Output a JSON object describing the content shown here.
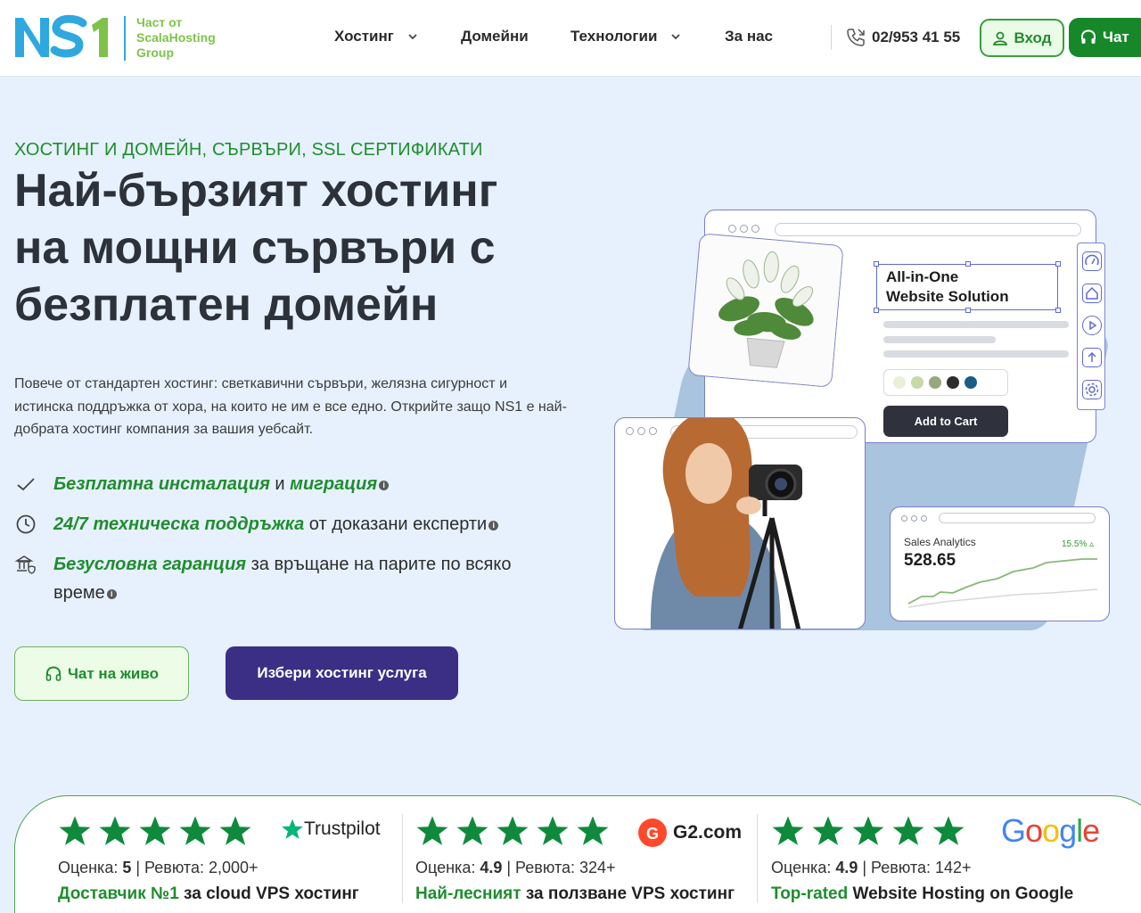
{
  "header": {
    "logo_tagline": [
      "Част от",
      "ScalaHosting",
      "Group"
    ],
    "nav": [
      {
        "label": "Хостинг",
        "has_dropdown": true
      },
      {
        "label": "Домейни",
        "has_dropdown": false
      },
      {
        "label": "Технологии",
        "has_dropdown": true
      },
      {
        "label": "За нас",
        "has_dropdown": false
      }
    ],
    "phone": "02/953 41 55",
    "login_label": "Вход",
    "chat_label": "Чат"
  },
  "hero": {
    "eyebrow": "ХОСТИНГ И ДОМЕЙН, СЪРВЪРИ, SSL СЕРТИФИКАТИ",
    "title_lines": [
      "Най-бързият хостинг",
      "на мощни сървъри с",
      "безплатен домейн"
    ],
    "description": "Повече от стандартен хостинг: светкавични сървъри, желязна сигурност и истинска поддръжка от хора, на които не им е все едно. Открийте защо NS1 е най-добрата хостинг компания за вашия уебсайт.",
    "features": [
      {
        "icon": "check-icon",
        "parts": [
          {
            "t": "Безплатна инсталация",
            "em": true
          },
          {
            "t": " и ",
            "em": false
          },
          {
            "t": "миграция",
            "em": true
          }
        ]
      },
      {
        "icon": "clock-icon",
        "parts": [
          {
            "t": "24/7 техническа поддръжка",
            "em": true
          },
          {
            "t": " от доказани експерти",
            "em": false
          }
        ]
      },
      {
        "icon": "bank-shield-icon",
        "parts": [
          {
            "t": "Безусловна гаранция",
            "em": true
          },
          {
            "t": " за връщане на парите по всяко време",
            "em": false
          }
        ]
      }
    ],
    "cta_live_chat": "Чат на живо",
    "cta_choose": "Избери хостинг услуга"
  },
  "illustration": {
    "heading_lines": [
      "All-in-One",
      "Website Solution"
    ],
    "add_to_cart": "Add to Cart",
    "swatch_colors": [
      "#e8f0da",
      "#c6d9a7",
      "#98a87d",
      "#2d2d2d",
      "#1b5e83"
    ],
    "analytics_label": "Sales Analytics",
    "analytics_value": "528.65",
    "analytics_change": "15.5%"
  },
  "ratings": [
    {
      "brand": "Trustpilot",
      "stars": 5,
      "score_label": "Оценка: ",
      "score": "5",
      "reviews": " | Ревюта: 2,000+",
      "claim_hl": "Доставчик №1",
      "claim_rest": " за cloud VPS хостинг"
    },
    {
      "brand": "G2.com",
      "stars": 5,
      "score_label": "Оценка: ",
      "score": "4.9",
      "reviews": " | Ревюта: 324+",
      "claim_hl": "Най-лесният",
      "claim_rest": " за ползване VPS хостинг"
    },
    {
      "brand": "Google",
      "stars": 5,
      "score_label": "Оценка: ",
      "score": "4.9",
      "reviews": " | Ревюта: 142+",
      "claim_hl": "Top-rated",
      "claim_rest": " Website Hosting on Google"
    }
  ],
  "colors": {
    "brand_green": "#1f8d2e",
    "brand_purple": "#3b2e85",
    "logo_blue": "#2fa8e0",
    "star_green": "#0f8a3c",
    "hero_bg": "#e6f1fd"
  }
}
